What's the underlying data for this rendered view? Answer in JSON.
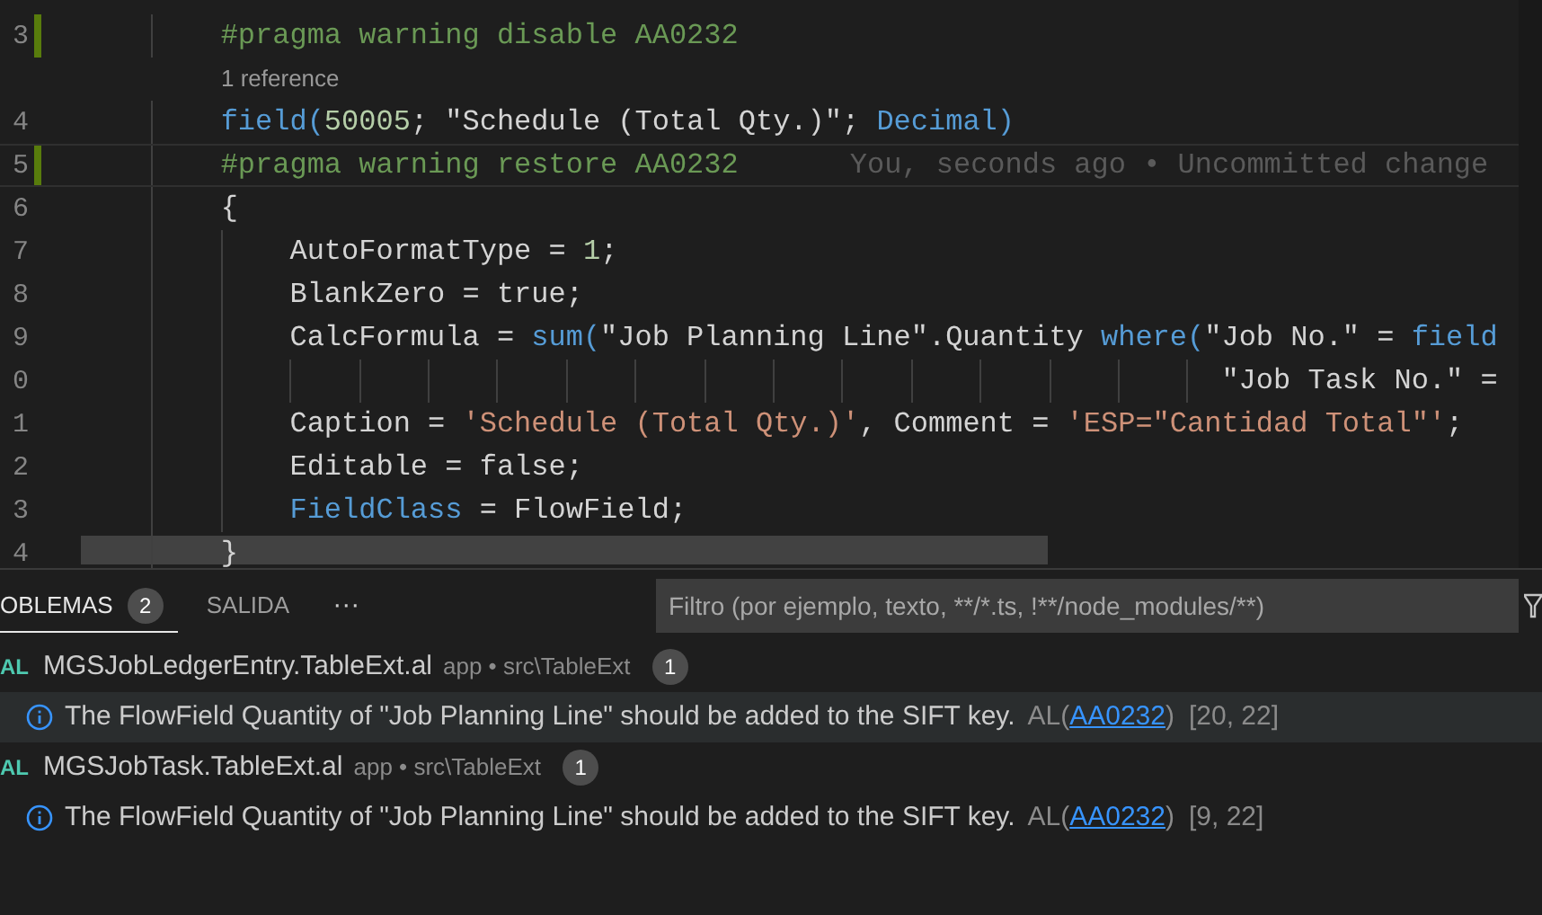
{
  "editor": {
    "lines": [
      {
        "kind": "code",
        "number": "3",
        "modified": true,
        "current": false,
        "tokens": [
          {
            "kind": "pragma",
            "text": "        #pragma warning disable AA0232"
          }
        ]
      },
      {
        "kind": "codelens",
        "text": "1 reference"
      },
      {
        "kind": "code",
        "number": "4",
        "modified": false,
        "current": false,
        "tokens": [
          {
            "kind": "keyword",
            "text": "        field("
          },
          {
            "kind": "number",
            "text": "50005"
          },
          {
            "kind": "plain",
            "text": "; \"Schedule (Total Qty.)\"; "
          },
          {
            "kind": "keyword",
            "text": "Decimal)"
          }
        ]
      },
      {
        "kind": "code",
        "number": "5",
        "modified": true,
        "current": true,
        "blame": "You, seconds ago • Uncommitted change",
        "tokens": [
          {
            "kind": "pragma",
            "text": "        #pragma warning restore AA0232"
          }
        ]
      },
      {
        "kind": "code",
        "number": "6",
        "modified": false,
        "current": false,
        "tokens": [
          {
            "kind": "plain",
            "text": "        {"
          }
        ]
      },
      {
        "kind": "code",
        "number": "7",
        "modified": false,
        "current": false,
        "tokens": [
          {
            "kind": "plain",
            "text": "            AutoFormatType = "
          },
          {
            "kind": "number",
            "text": "1"
          },
          {
            "kind": "plain",
            "text": ";"
          }
        ]
      },
      {
        "kind": "code",
        "number": "8",
        "modified": false,
        "current": false,
        "tokens": [
          {
            "kind": "plain",
            "text": "            BlankZero = true;"
          }
        ]
      },
      {
        "kind": "code",
        "number": "9",
        "modified": false,
        "current": false,
        "tokens": [
          {
            "kind": "plain",
            "text": "            CalcFormula = "
          },
          {
            "kind": "keyword",
            "text": "sum("
          },
          {
            "kind": "plain",
            "text": "\"Job Planning Line\".Quantity "
          },
          {
            "kind": "keyword",
            "text": "where("
          },
          {
            "kind": "plain",
            "text": "\"Job No.\" = "
          },
          {
            "kind": "keyword",
            "text": "field"
          }
        ]
      },
      {
        "kind": "code",
        "number": "0",
        "modified": false,
        "current": false,
        "tokens": [
          {
            "kind": "plain",
            "text": "                                                                  \"Job Task No.\" ="
          }
        ]
      },
      {
        "kind": "code",
        "number": "1",
        "modified": false,
        "current": false,
        "tokens": [
          {
            "kind": "plain",
            "text": "            Caption = "
          },
          {
            "kind": "string",
            "text": "'Schedule (Total Qty.)'"
          },
          {
            "kind": "plain",
            "text": ", Comment = "
          },
          {
            "kind": "string",
            "text": "'ESP=\"Cantidad Total\"'"
          },
          {
            "kind": "plain",
            "text": ";"
          }
        ]
      },
      {
        "kind": "code",
        "number": "2",
        "modified": false,
        "current": false,
        "tokens": [
          {
            "kind": "plain",
            "text": "            Editable = false;"
          }
        ]
      },
      {
        "kind": "code",
        "number": "3",
        "modified": false,
        "current": false,
        "tokens": [
          {
            "kind": "keyword",
            "text": "            FieldClass"
          },
          {
            "kind": "plain",
            "text": " = FlowField;"
          }
        ]
      },
      {
        "kind": "code",
        "number": "4",
        "modified": false,
        "current": false,
        "tokens": [
          {
            "kind": "plain",
            "text": "        }"
          }
        ]
      }
    ]
  },
  "panel": {
    "tabs": [
      {
        "label": "OBLEMAS",
        "badge": "2",
        "selected": true
      },
      {
        "label": "SALIDA",
        "selected": false
      }
    ],
    "more": "···",
    "filter": {
      "placeholder": "Filtro (por ejemplo, texto, **/*.ts, !**/node_modules/**)"
    },
    "items": [
      {
        "kind": "file",
        "lang": "AL",
        "name": "MGSJobLedgerEntry.TableExt.al",
        "path": "app • src\\TableExt",
        "count": "1"
      },
      {
        "kind": "message",
        "selected": true,
        "text": "The FlowField Quantity of \"Job Planning Line\" should be added to the SIFT key.",
        "source": "AL(",
        "code": "AA0232",
        "close": ")",
        "position": "[20, 22]"
      },
      {
        "kind": "file",
        "lang": "AL",
        "name": "MGSJobTask.TableExt.al",
        "path": "app • src\\TableExt",
        "count": "1"
      },
      {
        "kind": "message",
        "selected": false,
        "text": "The FlowField Quantity of \"Job Planning Line\" should be added to the SIFT key.",
        "source": "AL(",
        "code": "AA0232",
        "close": ")",
        "position": "[9, 22]"
      }
    ]
  }
}
